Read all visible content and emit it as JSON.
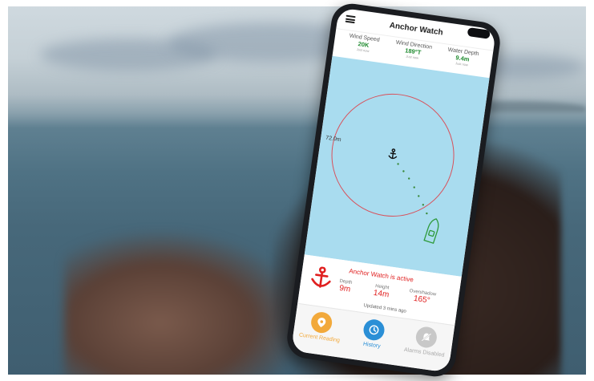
{
  "app": {
    "title": "Anchor Watch"
  },
  "stats": [
    {
      "label": "Wind Speed",
      "value": "20K",
      "sub": "Just now"
    },
    {
      "label": "Wind Direction",
      "value": "189°T",
      "sub": "Just now"
    },
    {
      "label": "Water Depth",
      "value": "9.4m",
      "sub": "Just now"
    }
  ],
  "map": {
    "radius_label": "72.0m"
  },
  "status": {
    "title": "Anchor Watch is active",
    "depth_label": "Depth",
    "depth_value": "9m",
    "height_label": "Height",
    "height_value": "14m",
    "overshadow_label": "Overshadow",
    "overshadow_value": "165°",
    "updated": "Updated 3 mins ago"
  },
  "nav": [
    {
      "label": "Current Reading"
    },
    {
      "label": "History"
    },
    {
      "label": "Alarms Disabled"
    }
  ],
  "colors": {
    "water": "#a9dcef",
    "alert_red": "#e02020",
    "value_green": "#1e8a2e",
    "nav_orange": "#f2a93b",
    "nav_blue": "#2b8fd6",
    "nav_grey": "#c8c8c8"
  },
  "icons": [
    "menu-icon",
    "anchor-icon",
    "boat-icon",
    "location-icon",
    "clock-icon",
    "alarm-off-icon"
  ]
}
